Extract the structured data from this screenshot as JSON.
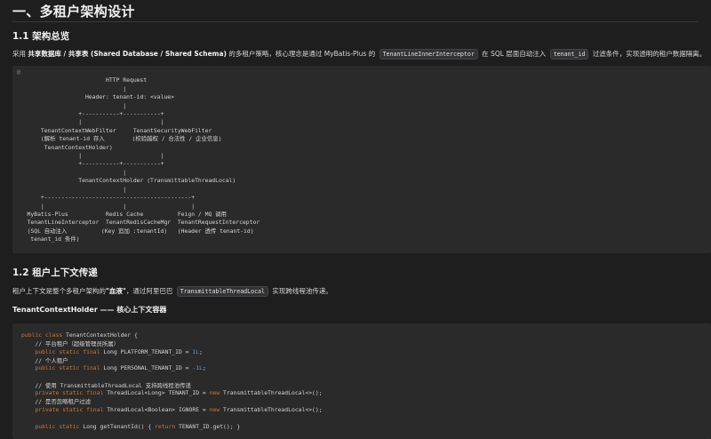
{
  "doc": {
    "title": "一、多租户架构设计",
    "section1": {
      "heading": "1.1 架构总览",
      "para": {
        "t1": "采用 ",
        "b1": "共享数据库 / 共享表 (Shared Database / Shared Schema)",
        "t2": " 的多租户策略，核心理念是通过 MyBatis-Plus 的 ",
        "c1": "TenantLineInnerInterceptor",
        "t3": " 在 SQL 层面自动注入 ",
        "c2": "tenant_id",
        "t4": " 过滤条件，实现透明的租户数据隔离。"
      },
      "diagram_marker": "@",
      "diagram": "                          HTTP Request\n                               |\n                    Header: tenant-id: <value>\n                               |\n                  +-----------+-----------+\n                  |                       |\n       TenantContextWebFilter     TenantSecurityWebFilter\n       (解析 tenant-id 存入        (校验越权 / 合法性 / 企业信息)\n        TenantContextHolder)\n                  |                       |\n                  +-----------+-----------+\n                               |\n                  TenantContextHolder (TransmittableThreadLocal)\n                               |\n       +-------------------------------------------+\n       |                       |                   |\n   MyBatis-Plus           Redis Cache          Feign / MQ 调用\n   TenantLineInterceptor  TenantRedisCacheMgr  TenantRequestInterceptor\n   (SQL 自动注入          (Key 追加 :tenantId)   (Header 透传 tenant-id)\n    tenant_id 条件)"
    },
    "section2": {
      "heading": "1.2 租户上下文传递",
      "para": {
        "t1": "租户上下文是整个多租户架构的",
        "b1": "\"血液\"",
        "t2": "，通过阿里巴巴 ",
        "c1": "TransmittableThreadLocal",
        "t3": " 实现跨线程池传递。"
      },
      "subheading": "TenantContextHolder —— 核心上下文容器",
      "code": {
        "l1_kw": "public class",
        "l1_rest": " TenantContextHolder {",
        "l2": "    // 平台租户（超级管理员所属）",
        "l3_kw": "    public static final",
        "l3_mid": " Long PLATFORM_TENANT_ID = ",
        "l3_num": "1L",
        "l3_end": ";",
        "l4": "    // 个人租户",
        "l5_kw": "    public static final",
        "l5_mid": " Long PERSONAL_TENANT_ID = ",
        "l5_num": "-1L",
        "l5_end": ";",
        "l6": "    // 使用 TransmittableThreadLocal 支持跨线程池传递",
        "l7_kw": "    private static final",
        "l7_mid": " ThreadLocal<Long> TENANT_ID = ",
        "l7_new": "new",
        "l7_end": " TransmittableThreadLocal<>();",
        "l8": "    // 是否忽略租户过滤",
        "l9_kw": "    private static final",
        "l9_mid": " ThreadLocal<Boolean> IGNORE = ",
        "l9_new": "new",
        "l9_end": " TransmittableThreadLocal<>();",
        "l10_kw": "    public static",
        "l10_mid": " Long getTenantId() { ",
        "l10_ret": "return",
        "l10_end": " TENANT_ID.get(); }"
      }
    }
  }
}
